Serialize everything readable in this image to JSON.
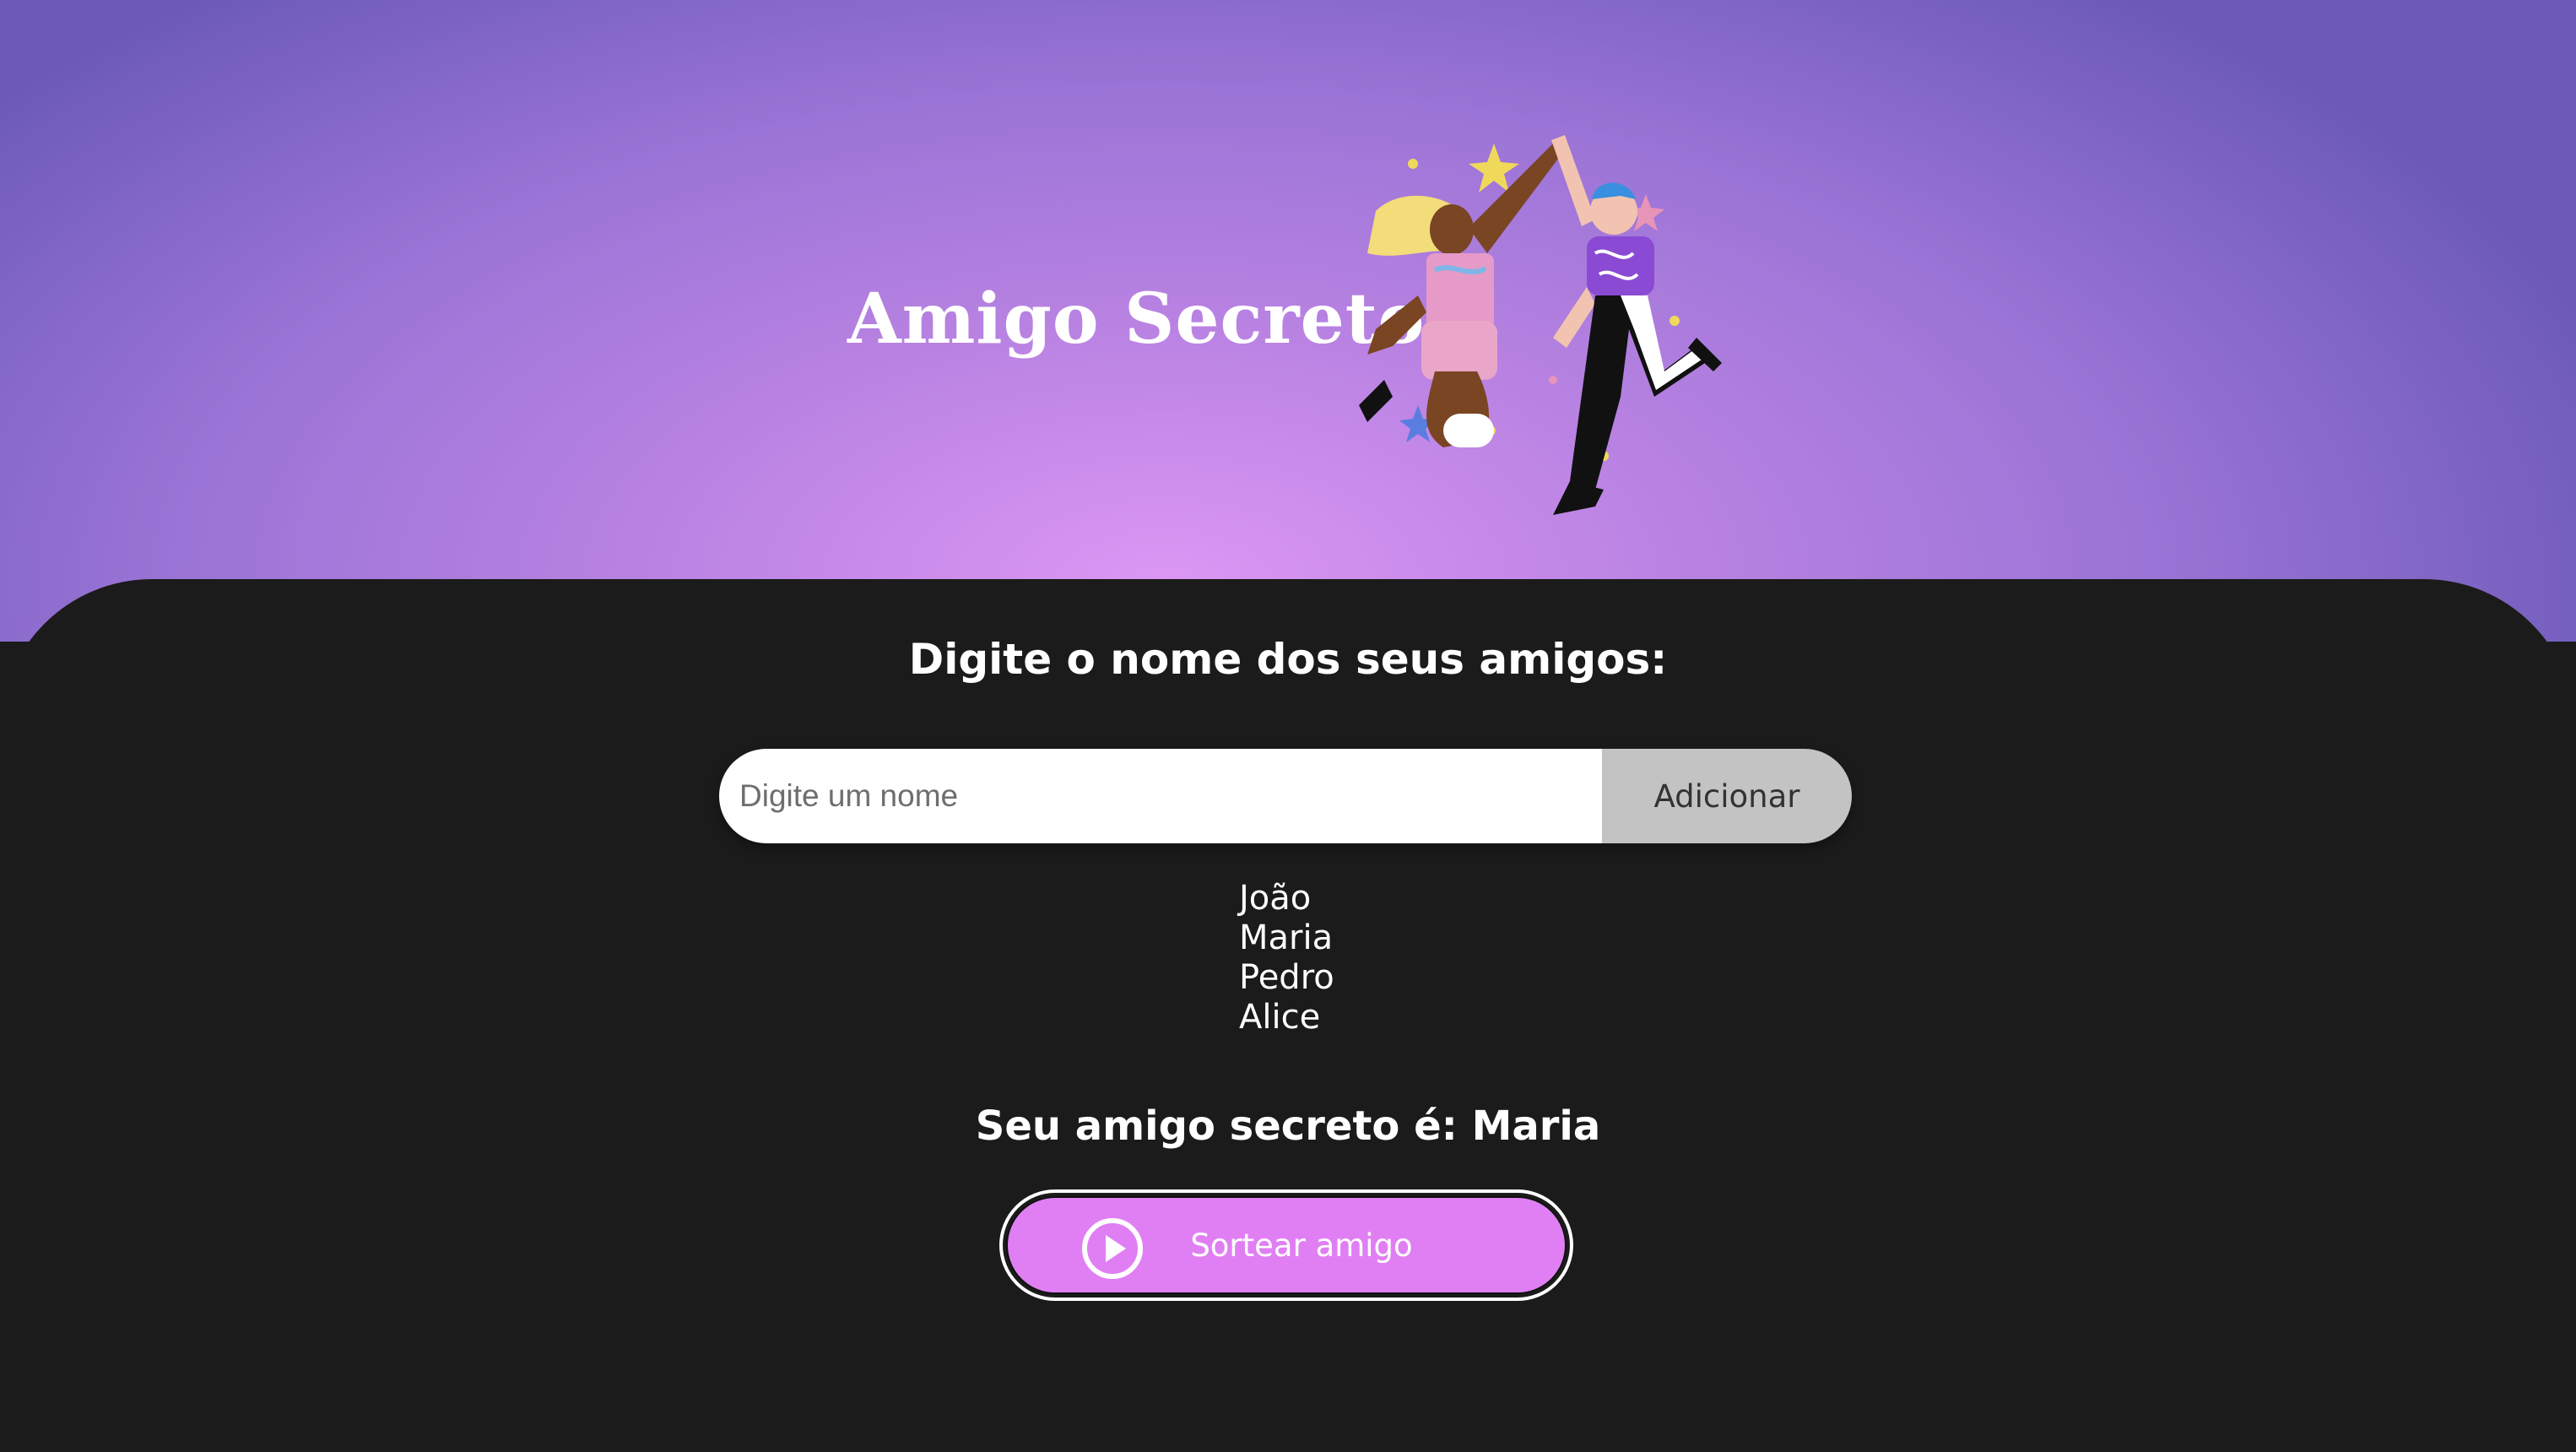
{
  "header": {
    "title": "Amigo Secreto",
    "background_colors": [
      "#6c5ab8",
      "#9a74d6",
      "#dc97f4"
    ],
    "illustration": "two-friends-high-five-illustration"
  },
  "form": {
    "subtitle": "Digite o nome dos seus amigos:",
    "input_placeholder": "Digite um nome",
    "input_value": "",
    "add_button_label": "Adicionar"
  },
  "friends": [
    "João",
    "Maria",
    "Pedro",
    "Alice"
  ],
  "result": {
    "text": "Seu amigo secreto é: Maria"
  },
  "draw_button": {
    "label": "Sortear amigo",
    "icon": "play-circle-icon",
    "color": "#e07ff3"
  },
  "colors": {
    "main_background": "#1b1b1b",
    "add_button": "#c3c3c3",
    "text": "#ffffff"
  }
}
